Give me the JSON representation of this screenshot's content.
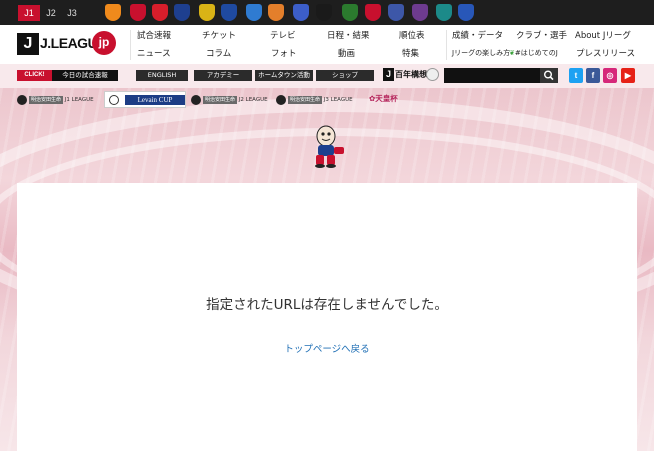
{
  "league_tabs": [
    {
      "label": "J1",
      "active": true
    },
    {
      "label": "J2",
      "active": false
    },
    {
      "label": "J3",
      "active": false
    }
  ],
  "club_crests": [
    {
      "icon": "club-crest-icon",
      "color": "#f08a1c"
    },
    {
      "icon": "club-crest-icon",
      "color": "#c8102e"
    },
    {
      "icon": "club-crest-icon",
      "color": "#d81e2b"
    },
    {
      "icon": "club-crest-icon",
      "color": "#1e3f8f"
    },
    {
      "icon": "club-crest-icon",
      "color": "#d9b316"
    },
    {
      "icon": "club-crest-icon",
      "color": "#1f4aa0"
    },
    {
      "icon": "club-crest-icon",
      "color": "#2f7bd1"
    },
    {
      "icon": "club-crest-icon",
      "color": "#e47f2b"
    },
    {
      "icon": "club-crest-icon",
      "color": "#3c5ec9"
    },
    {
      "icon": "club-crest-icon",
      "color": "#1a1a1a"
    },
    {
      "icon": "club-crest-icon",
      "color": "#2b7a2e"
    },
    {
      "icon": "club-crest-icon",
      "color": "#c8102e"
    },
    {
      "icon": "club-crest-icon",
      "color": "#3d57a8"
    },
    {
      "icon": "club-crest-icon",
      "color": "#6e3b8f"
    },
    {
      "icon": "club-crest-icon",
      "color": "#1c8a89"
    },
    {
      "icon": "club-crest-icon",
      "color": "#2857b8"
    }
  ],
  "logo": {
    "j": "J",
    "text": "J.LEAGUE",
    "jp": "jp"
  },
  "nav": {
    "row1": [
      "試合速報",
      "チケット",
      "テレビ",
      "日程・結果",
      "順位表",
      "成績・データ",
      "クラブ・選手",
      "About Jリーグ"
    ],
    "row2": [
      "ニュース",
      "コラム",
      "フォト",
      "動画",
      "特集",
      "Jリーグの楽しみ方",
      "#はじめてのJ",
      "プレスリリース"
    ]
  },
  "sub_bar": {
    "click_label": "CLICK!",
    "today_label": "今日の試合速報",
    "buttons": [
      "ENGLISH",
      "アカデミー",
      "ホームタウン活動",
      "ショップ"
    ],
    "hyakunen": {
      "j": "J",
      "text": "百年構想"
    },
    "search_placeholder": "",
    "sns": [
      {
        "icon": "twitter-icon",
        "glyph": "t",
        "color": "#1da1f2"
      },
      {
        "icon": "facebook-icon",
        "glyph": "f",
        "color": "#3b5998"
      },
      {
        "icon": "instagram-icon",
        "glyph": "◎",
        "color": "#d6287a"
      },
      {
        "icon": "youtube-icon",
        "glyph": "▶",
        "color": "#e62117"
      }
    ]
  },
  "competitions": [
    {
      "tag": "明治安田生命",
      "name": "J1 LEAGUE"
    },
    {
      "levain": "Levain CUP"
    },
    {
      "tag": "明治安田生命",
      "name": "J2 LEAGUE"
    },
    {
      "tag": "明治安田生命",
      "name": "J3 LEAGUE"
    },
    {
      "name": "天皇杯"
    }
  ],
  "main": {
    "error_message": "指定されたURLは存在しませんでした。",
    "top_link": "トップページへ戻る"
  }
}
